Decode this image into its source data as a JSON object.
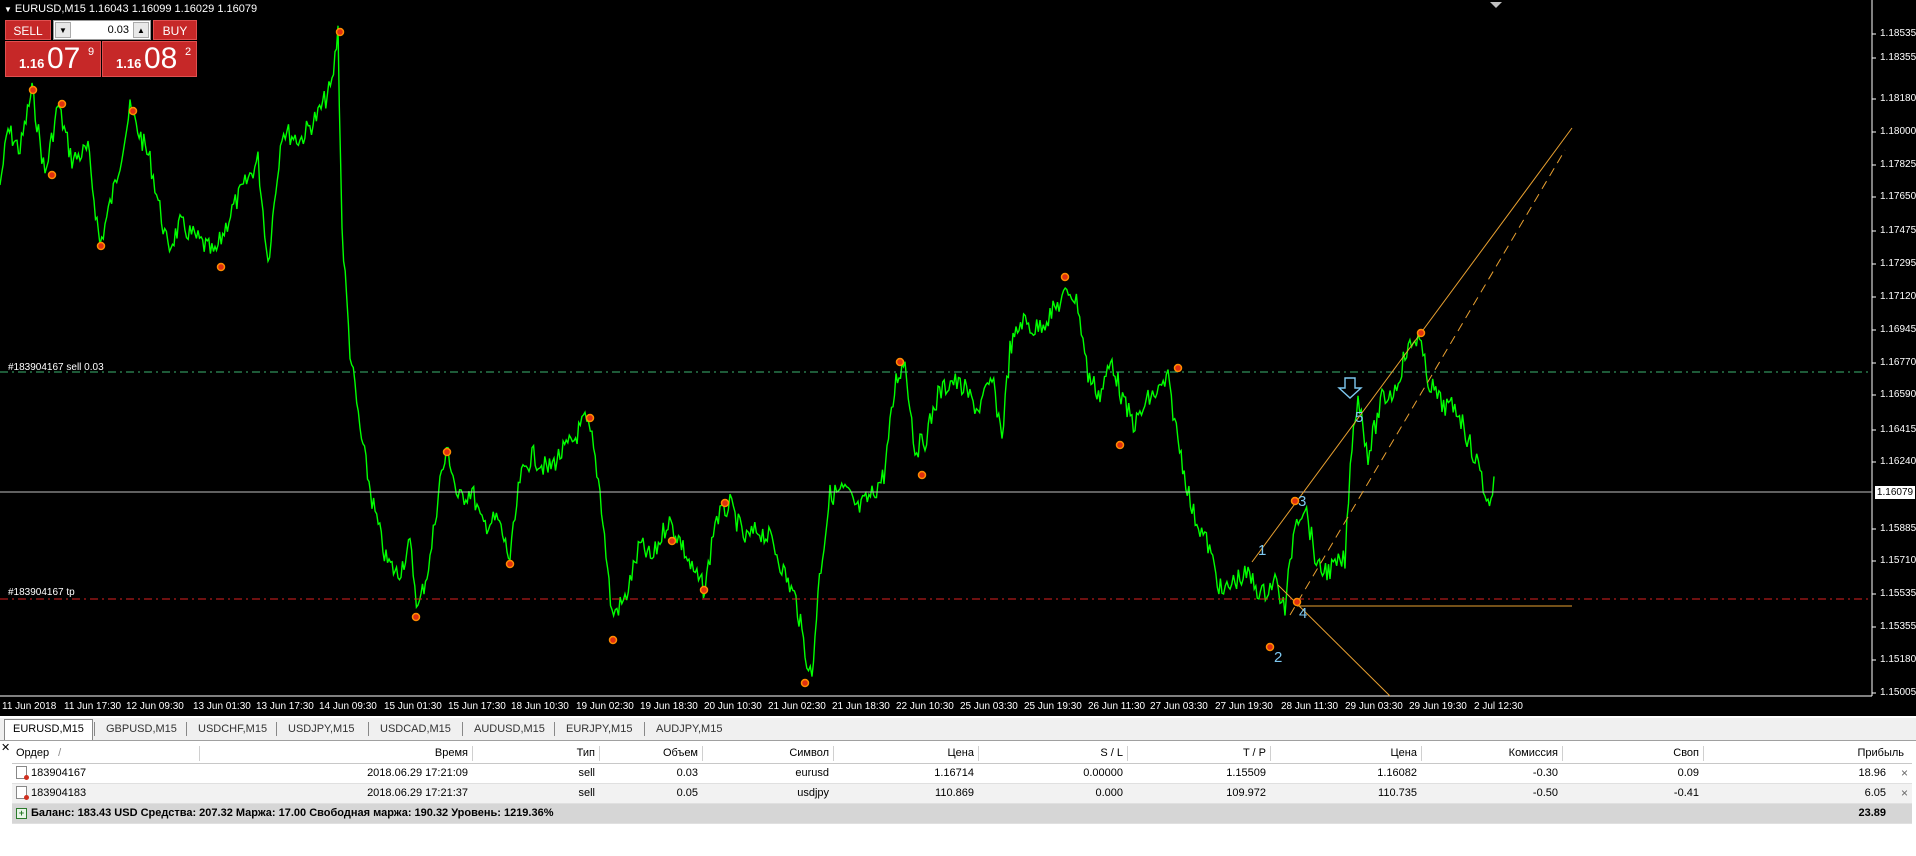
{
  "window": {
    "symbol_info": "EURUSD,M15  1.16043 1.16099 1.16029 1.16079"
  },
  "trade_panel": {
    "sell_label": "SELL",
    "buy_label": "BUY",
    "lot_value": "0.03",
    "sell_price": {
      "small": "1.16",
      "big": "07",
      "sup": "9"
    },
    "buy_price": {
      "small": "1.16",
      "big": "08",
      "sup": "2"
    }
  },
  "line_labels": {
    "sell_line": "#183904167 sell 0.03",
    "tp_line": "#183904167 tp"
  },
  "price_scale": [
    "1.18535",
    "1.18355",
    "1.18180",
    "1.18000",
    "1.17825",
    "1.17650",
    "1.17475",
    "1.17295",
    "1.17120",
    "1.16945",
    "1.16770",
    "1.16590",
    "1.16415",
    "1.16240",
    "1.15885",
    "1.15710",
    "1.15535",
    "1.15355",
    "1.15180",
    "1.15005"
  ],
  "current_price": "1.16079",
  "time_axis": [
    "11 Jun 2018",
    "11 Jun 17:30",
    "12 Jun 09:30",
    "13 Jun 01:30",
    "13 Jun 17:30",
    "14 Jun 09:30",
    "15 Jun 01:30",
    "15 Jun 17:30",
    "18 Jun 10:30",
    "19 Jun 02:30",
    "19 Jun 18:30",
    "20 Jun 10:30",
    "21 Jun 02:30",
    "21 Jun 18:30",
    "22 Jun 10:30",
    "25 Jun 03:30",
    "25 Jun 19:30",
    "26 Jun 11:30",
    "27 Jun 03:30",
    "27 Jun 19:30",
    "28 Jun 11:30",
    "29 Jun 03:30",
    "29 Jun 19:30",
    "2 Jul 12:30"
  ],
  "wave_labels": [
    "1",
    "2",
    "3",
    "4",
    "5"
  ],
  "colors": {
    "candle": "#00ff00",
    "fractal": "#ff8c00",
    "sell_line": "#3cb371",
    "tp_line": "#dc2020",
    "channel": "#e8a030",
    "wave_text": "#7ec8f0"
  },
  "tabs": [
    "EURUSD,M15",
    "GBPUSD,M15",
    "USDCHF,M15",
    "USDJPY,M15",
    "USDCAD,M15",
    "AUDUSD,M15",
    "EURJPY,M15",
    "AUDJPY,M15"
  ],
  "table": {
    "headers": [
      "Ордер",
      "Время",
      "Тип",
      "Объем",
      "Символ",
      "Цена",
      "S / L",
      "T / P",
      "Цена",
      "Комиссия",
      "Своп",
      "Прибыль"
    ],
    "sort_mark": "/",
    "rows": [
      [
        "183904167",
        "2018.06.29 17:21:09",
        "sell",
        "0.03",
        "eurusd",
        "1.16714",
        "0.00000",
        "1.15509",
        "1.16082",
        "-0.30",
        "0.09",
        "18.96"
      ],
      [
        "183904183",
        "2018.06.29 17:21:37",
        "sell",
        "0.05",
        "usdjpy",
        "110.869",
        "0.000",
        "109.972",
        "110.735",
        "-0.50",
        "-0.41",
        "6.05"
      ]
    ],
    "balance_text": "Баланс: 183.43 USD  Средства: 207.32  Маржа: 17.00  Свободная маржа: 190.32  Уровень: 1219.36%",
    "balance_total": "23.89"
  }
}
